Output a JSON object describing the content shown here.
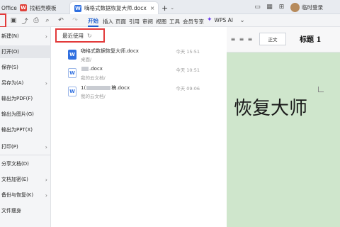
{
  "tabbar": {
    "tabs": [
      {
        "label": "Office",
        "icon": "office-icon"
      },
      {
        "label": "找稻壳模板",
        "icon": "wps-icon"
      },
      {
        "label": "嗨格式数据恢复大师.docx",
        "icon": "word-icon"
      }
    ],
    "add_label": "+",
    "user_label": "临时登录"
  },
  "toolbar": {
    "menus": [
      "开始",
      "插入",
      "页面",
      "引用",
      "审阅",
      "视图",
      "工具",
      "会员专享"
    ],
    "ai_label": "WPS AI"
  },
  "sidebar": {
    "items": [
      {
        "label": "新建(N)",
        "arrow": true
      },
      {
        "label": "打开(O)",
        "arrow": false
      },
      {
        "label": "保存(S)",
        "arrow": false
      },
      {
        "label": "另存为(A)",
        "arrow": true
      },
      {
        "label": "输出为PDF(F)",
        "arrow": false
      },
      {
        "label": "输出为图片(G)",
        "arrow": false
      },
      {
        "label": "输出为PPT(X)",
        "arrow": false
      },
      {
        "label": "打印(P)",
        "arrow": true
      },
      {
        "label": "分享文档(D)",
        "arrow": false
      },
      {
        "label": "文档加密(E)",
        "arrow": true
      },
      {
        "label": "备份与恢复(K)",
        "arrow": true
      },
      {
        "label": "文件瘦身",
        "arrow": false
      }
    ]
  },
  "panel": {
    "recent_label": "最近使用",
    "files": [
      {
        "name": "嗨格式数据恢复大师.docx",
        "path": "桌面/",
        "time": "今天 15:51"
      },
      {
        "name": ".docx",
        "path": "我的云文档/",
        "time": "今天 10:51"
      },
      {
        "name": "1(",
        "name_tail": "稿.docx",
        "path": "我的云文档/",
        "time": "今天 09:06"
      }
    ]
  },
  "document": {
    "style_body": "正文",
    "style_h1": "标题 1",
    "visible_text": "恢复大师"
  },
  "colors": {
    "accent": "#1f5fcf",
    "highlight": "#e23a3a",
    "doc_bg": "#cfe6cc"
  }
}
